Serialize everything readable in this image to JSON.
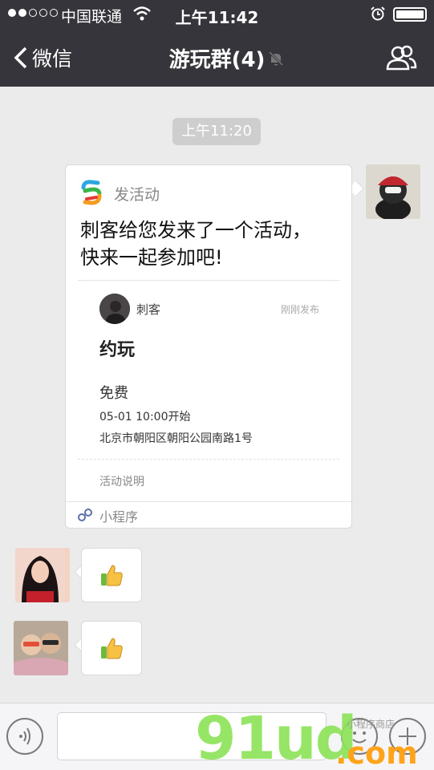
{
  "status_bar": {
    "carrier": "中国联通",
    "time": "上午11:42"
  },
  "nav": {
    "back_label": "微信",
    "title": "游玩群(4)"
  },
  "messages": {
    "timestamp": "上午11:20",
    "card": {
      "app_name": "发活动",
      "message": "刺客给您发来了一个活动，快来一起参加吧!",
      "poster_name": "刺客",
      "post_time": "刚刚发布",
      "event_title": "约玩",
      "price": "免费",
      "start_time": "05-01 10:00开始",
      "address": "北京市朝阳区朝阳公园南路1号",
      "description_label": "活动说明",
      "footer_label": "小程序"
    },
    "reply_icon": "thumbs-up-icon"
  },
  "watermark": {
    "main": "91ud",
    "suffix": ".com",
    "small": "小程序商店"
  },
  "colors": {
    "nav_background": "#36353b",
    "chat_background": "#ebebeb",
    "watermark_green": "#8ee35a",
    "watermark_orange": "#ffa31a"
  }
}
